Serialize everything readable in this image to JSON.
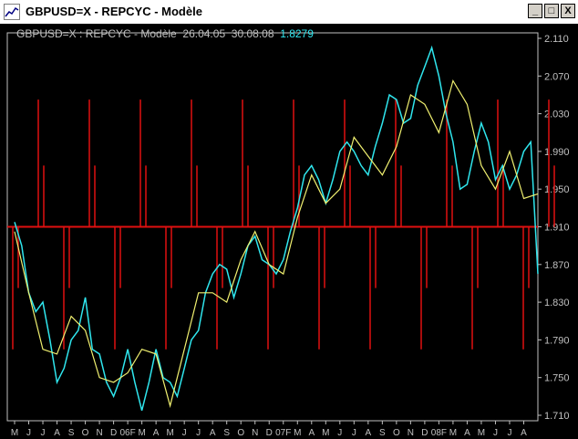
{
  "window": {
    "title": "GBPUSD=X - REPCYC - Modèle",
    "buttons": {
      "minimize": "_",
      "maximize": "□",
      "close": "X"
    }
  },
  "info_line": {
    "symbol": "GBPUSD=X : REPCYC - Modèle",
    "start_date": "26.04.05",
    "end_date": "30.08.08",
    "last_value": "1.8279"
  },
  "colors": {
    "background": "#000000",
    "price": "#2fe6ee",
    "model": "#f0f070",
    "cycles": "#e01010",
    "axis": "#c0c0c0"
  },
  "chart_data": {
    "type": "line",
    "title": "GBPUSD=X : REPCYC - Modèle",
    "ylim": [
      1.71,
      2.11
    ],
    "yticks": [
      "2.110",
      "2.070",
      "2.030",
      "1.990",
      "1.950",
      "1.910",
      "1.870",
      "1.830",
      "1.790",
      "1.750",
      "1.710"
    ],
    "xticks": [
      "M",
      "J",
      "J",
      "A",
      "S",
      "O",
      "N",
      "D",
      "06F",
      "M",
      "A",
      "M",
      "J",
      "J",
      "A",
      "S",
      "O",
      "N",
      "D",
      "07F",
      "M",
      "A",
      "M",
      "J",
      "J",
      "A",
      "S",
      "O",
      "N",
      "D",
      "08F",
      "M",
      "A",
      "M",
      "J",
      "J",
      "A"
    ],
    "reference_level": 1.91,
    "series": [
      {
        "name": "price",
        "x": [
          0,
          0.5,
          1,
          1.5,
          2,
          2.5,
          3,
          3.5,
          4,
          4.5,
          5,
          5.5,
          6,
          6.5,
          7,
          7.5,
          8,
          8.5,
          9,
          9.5,
          10,
          10.5,
          11,
          11.5,
          12,
          12.5,
          13,
          13.5,
          14,
          14.5,
          15,
          15.5,
          16,
          16.5,
          17,
          17.5,
          18,
          18.5,
          19,
          19.5,
          20,
          20.5,
          21,
          21.5,
          22,
          22.5,
          23,
          23.5,
          24,
          24.5,
          25,
          25.5,
          26,
          26.5,
          27,
          27.5,
          28,
          28.5,
          29,
          29.5,
          30,
          30.5,
          31,
          31.5,
          32,
          32.5,
          33,
          33.5,
          34,
          34.5,
          35,
          35.5,
          36,
          36.5,
          37
        ],
        "values": [
          1.915,
          1.89,
          1.84,
          1.82,
          1.83,
          1.79,
          1.745,
          1.76,
          1.79,
          1.8,
          1.835,
          1.78,
          1.775,
          1.745,
          1.73,
          1.75,
          1.78,
          1.745,
          1.715,
          1.745,
          1.78,
          1.75,
          1.745,
          1.73,
          1.76,
          1.79,
          1.8,
          1.84,
          1.86,
          1.87,
          1.865,
          1.835,
          1.86,
          1.89,
          1.9,
          1.875,
          1.87,
          1.86,
          1.875,
          1.905,
          1.93,
          1.965,
          1.975,
          1.96,
          1.935,
          1.96,
          1.99,
          2.0,
          1.99,
          1.975,
          1.965,
          1.995,
          2.02,
          2.05,
          2.045,
          2.02,
          2.025,
          2.06,
          2.08,
          2.1,
          2.07,
          2.03,
          2.0,
          1.95,
          1.955,
          1.99,
          2.02,
          2.0,
          1.96,
          1.975,
          1.95,
          1.965,
          1.99,
          2.0,
          1.86
        ]
      },
      {
        "name": "model",
        "x": [
          0,
          1,
          2,
          3,
          4,
          5,
          6,
          7,
          8,
          9,
          10,
          11,
          12,
          13,
          14,
          15,
          16,
          17,
          18,
          19,
          20,
          21,
          22,
          23,
          24,
          25,
          26,
          27,
          28,
          29,
          30,
          31,
          32,
          33,
          34,
          35,
          36,
          37
        ],
        "values": [
          1.905,
          1.84,
          1.78,
          1.775,
          1.815,
          1.8,
          1.75,
          1.745,
          1.755,
          1.78,
          1.775,
          1.72,
          1.78,
          1.84,
          1.84,
          1.83,
          1.875,
          1.905,
          1.87,
          1.86,
          1.92,
          1.965,
          1.935,
          1.95,
          2.005,
          1.985,
          1.965,
          1.995,
          2.05,
          2.04,
          2.01,
          2.065,
          2.04,
          1.975,
          1.95,
          1.99,
          1.94,
          1.945
        ]
      }
    ]
  }
}
